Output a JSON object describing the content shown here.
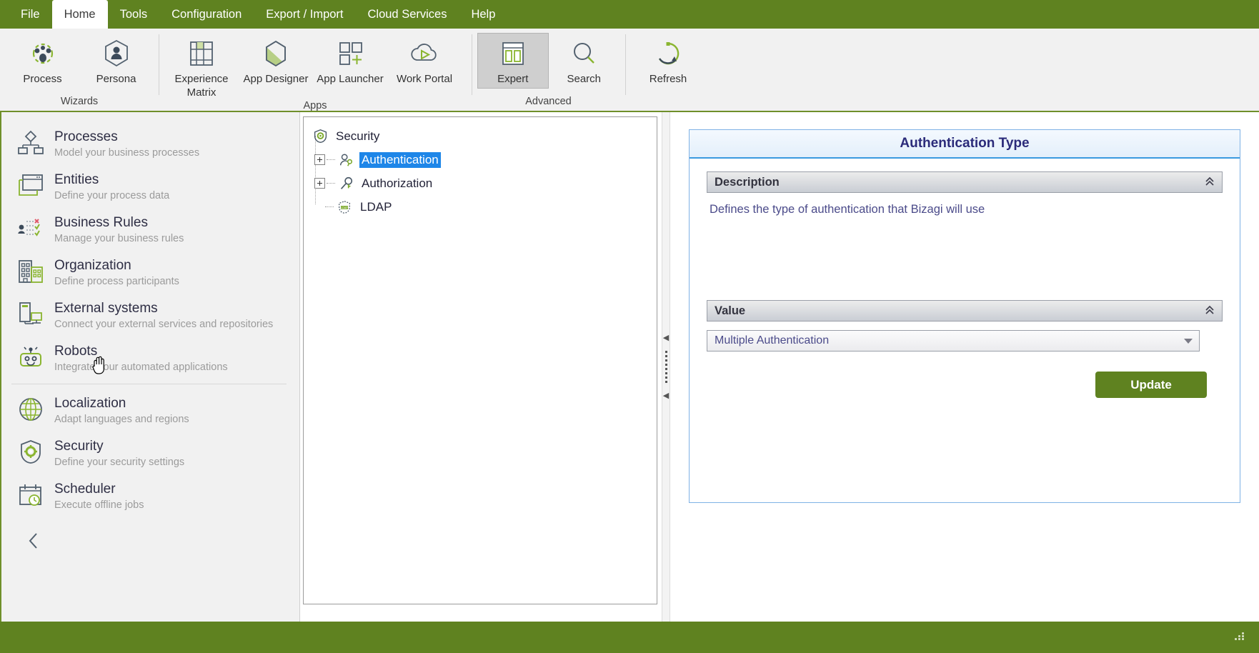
{
  "menubar": {
    "items": [
      {
        "label": "File",
        "active": false
      },
      {
        "label": "Home",
        "active": true
      },
      {
        "label": "Tools",
        "active": false
      },
      {
        "label": "Configuration",
        "active": false
      },
      {
        "label": "Export / Import",
        "active": false
      },
      {
        "label": "Cloud Services",
        "active": false
      },
      {
        "label": "Help",
        "active": false
      }
    ]
  },
  "ribbon": {
    "groups": [
      {
        "caption": "Wizards",
        "buttons": [
          {
            "label": "Process",
            "icon": "process-icon",
            "selected": false
          },
          {
            "label": "Persona",
            "icon": "persona-icon",
            "selected": false
          }
        ]
      },
      {
        "caption": "Apps",
        "buttons": [
          {
            "label": "Experience Matrix",
            "icon": "experience-matrix-icon",
            "selected": false
          },
          {
            "label": "App Designer",
            "icon": "app-designer-icon",
            "selected": false
          },
          {
            "label": "App Launcher",
            "icon": "app-launcher-icon",
            "selected": false
          },
          {
            "label": "Work Portal",
            "icon": "work-portal-icon",
            "selected": false
          }
        ]
      },
      {
        "caption": "Advanced",
        "buttons": [
          {
            "label": "Expert",
            "icon": "expert-icon",
            "selected": true
          },
          {
            "label": "Search",
            "icon": "search-icon",
            "selected": false
          }
        ]
      },
      {
        "caption": "",
        "buttons": [
          {
            "label": "Refresh",
            "icon": "refresh-icon",
            "selected": false
          }
        ]
      }
    ]
  },
  "sidebar": {
    "items": [
      {
        "title": "Processes",
        "subtitle": "Model your business processes",
        "icon": "process-flow-icon"
      },
      {
        "title": "Entities",
        "subtitle": "Define your process data",
        "icon": "entities-window-icon"
      },
      {
        "title": "Business Rules",
        "subtitle": "Manage your business rules",
        "icon": "business-rules-icon"
      },
      {
        "title": "Organization",
        "subtitle": "Define process participants",
        "icon": "organization-building-icon"
      },
      {
        "title": "External systems",
        "subtitle": "Connect your external services and repositories",
        "icon": "external-systems-icon"
      },
      {
        "title": "Robots",
        "subtitle": "Integrate your automated applications",
        "icon": "robot-icon"
      },
      {
        "title": "Localization",
        "subtitle": "Adapt languages and regions",
        "icon": "globe-icon"
      },
      {
        "title": "Security",
        "subtitle": "Define your security settings",
        "icon": "shield-gear-icon"
      },
      {
        "title": "Scheduler",
        "subtitle": "Execute offline jobs",
        "icon": "calendar-clock-icon"
      }
    ],
    "collapse_label": "‹"
  },
  "tree": {
    "nodes": [
      {
        "label": "Security",
        "icon": "security-shield-icon",
        "level": 0,
        "expander": false,
        "selected": false
      },
      {
        "label": "Authentication",
        "icon": "authentication-icon",
        "level": 1,
        "expander": true,
        "selected": true
      },
      {
        "label": "Authorization",
        "icon": "authorization-key-icon",
        "level": 1,
        "expander": true,
        "selected": false
      },
      {
        "label": "LDAP",
        "icon": "ldap-icon",
        "level": 1,
        "expander": false,
        "selected": false
      }
    ]
  },
  "splitter": {
    "arrow_up": "◀",
    "arrow_down": "◀"
  },
  "detail": {
    "title": "Authentication Type",
    "description_section": {
      "header": "Description",
      "chevron": "«",
      "text": "Defines the type of authentication that Bizagi will use"
    },
    "value_section": {
      "header": "Value",
      "chevron": "«",
      "selected_value": "Multiple Authentication"
    },
    "update_button": "Update"
  },
  "statusbar": {
    "text": "",
    "grip_icon": "resize-grip-icon"
  },
  "colors": {
    "brand_green": "#5f8220",
    "ribbon_border_green": "#6f8f2a",
    "selection_blue": "#1e86e8",
    "card_border_blue": "#7fb2e5",
    "title_navy": "#2b2b7a",
    "text_purple": "#4b4b8a",
    "icon_green": "#8ab530",
    "icon_slate": "#53616f"
  }
}
